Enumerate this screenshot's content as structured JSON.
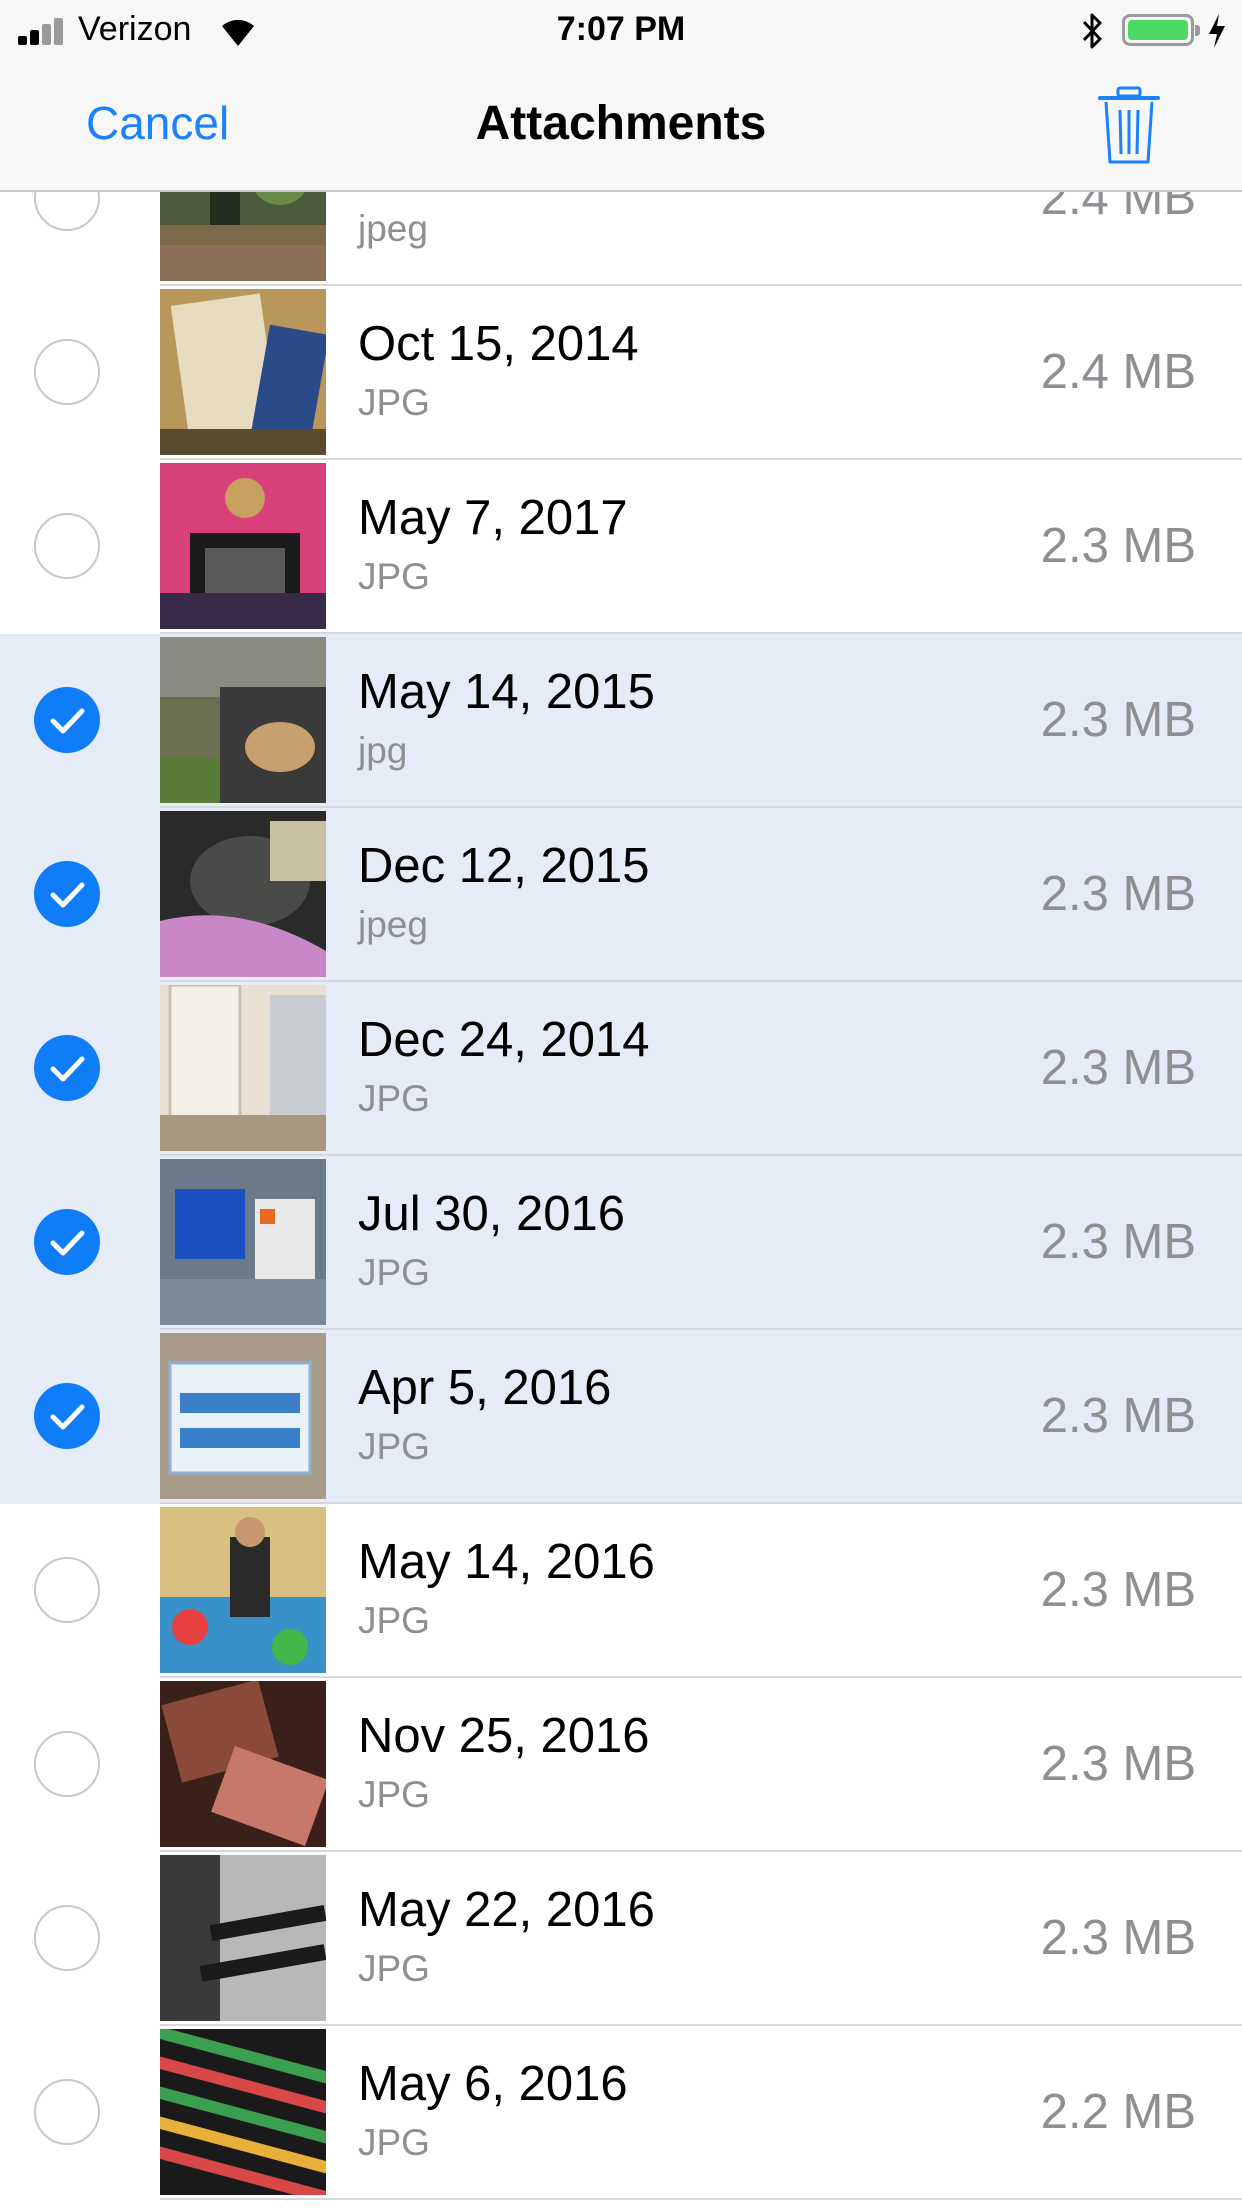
{
  "status_bar": {
    "carrier": "Verizon",
    "time": "7:07 PM",
    "battery_color": "#4cd964",
    "icons": [
      "signal-icon",
      "wifi-icon",
      "bluetooth-icon",
      "battery-icon",
      "charging-icon"
    ]
  },
  "nav": {
    "cancel_label": "Cancel",
    "title": "Attachments",
    "trash_icon": "trash-icon"
  },
  "colors": {
    "accent": "#1a82fb",
    "selected_row_bg": "#e6ecf7",
    "checkmark_fill": "#0f7cf8"
  },
  "attachments": [
    {
      "date": "",
      "type": "jpeg",
      "size": "2.4 MB",
      "selected": false
    },
    {
      "date": "Oct 15, 2014",
      "type": "JPG",
      "size": "2.4 MB",
      "selected": false
    },
    {
      "date": "May 7, 2017",
      "type": "JPG",
      "size": "2.3 MB",
      "selected": false
    },
    {
      "date": "May 14, 2015",
      "type": "jpg",
      "size": "2.3 MB",
      "selected": true
    },
    {
      "date": "Dec 12, 2015",
      "type": "jpeg",
      "size": "2.3 MB",
      "selected": true
    },
    {
      "date": "Dec 24, 2014",
      "type": "JPG",
      "size": "2.3 MB",
      "selected": true
    },
    {
      "date": "Jul 30, 2016",
      "type": "JPG",
      "size": "2.3 MB",
      "selected": true
    },
    {
      "date": "Apr 5, 2016",
      "type": "JPG",
      "size": "2.3 MB",
      "selected": true
    },
    {
      "date": "May 14, 2016",
      "type": "JPG",
      "size": "2.3 MB",
      "selected": false
    },
    {
      "date": "Nov 25, 2016",
      "type": "JPG",
      "size": "2.3 MB",
      "selected": false
    },
    {
      "date": "May 22, 2016",
      "type": "JPG",
      "size": "2.3 MB",
      "selected": false
    },
    {
      "date": "May 6, 2016",
      "type": "JPG",
      "size": "2.2 MB",
      "selected": false
    }
  ]
}
